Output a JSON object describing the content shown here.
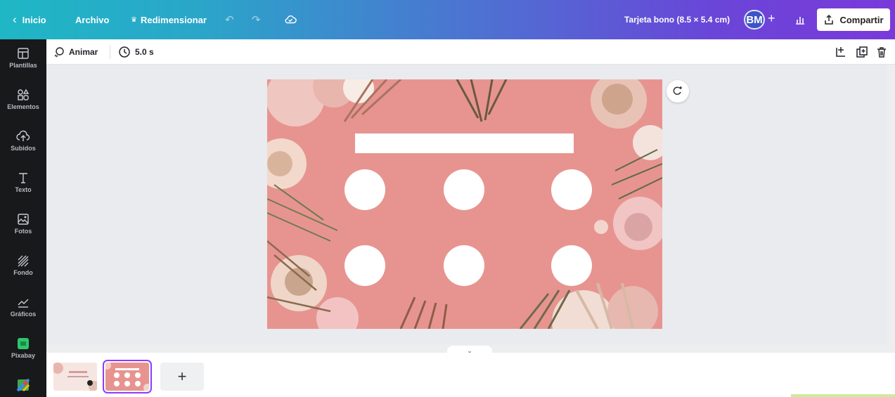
{
  "topbar": {
    "home_label": "Inicio",
    "file_label": "Archivo",
    "resize_label": "Redimensionar",
    "doc_title": "Tarjeta bono (8.5 × 5.4 cm)",
    "avatar_initials": "BM",
    "add_member": "+",
    "share_label": "Compartir",
    "gradient_start": "#1fb7c5",
    "gradient_end": "#7a3ad9"
  },
  "sidebar": {
    "items": [
      {
        "label": "Plantillas",
        "icon": "templates-icon"
      },
      {
        "label": "Elementos",
        "icon": "elements-icon"
      },
      {
        "label": "Subidos",
        "icon": "upload-icon"
      },
      {
        "label": "Texto",
        "icon": "text-icon"
      },
      {
        "label": "Fotos",
        "icon": "photos-icon"
      },
      {
        "label": "Fondo",
        "icon": "background-icon"
      },
      {
        "label": "Gráficos",
        "icon": "charts-icon"
      },
      {
        "label": "Pixabay",
        "icon": "pixabay-icon"
      },
      {
        "label": "",
        "icon": "maps-icon"
      }
    ]
  },
  "toolbar": {
    "animate_label": "Animar",
    "duration_label": "5.0 s"
  },
  "design": {
    "background_color": "#e79491",
    "stamp_count": 6
  },
  "pages": {
    "add_label": "+",
    "selected_page": 2,
    "total_pages": 2
  }
}
